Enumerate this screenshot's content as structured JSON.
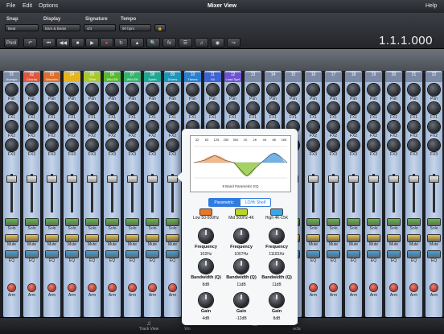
{
  "menu": {
    "items": [
      "File",
      "Edit",
      "Options"
    ],
    "title": "Mixer View",
    "help": "Help"
  },
  "toolbar": {
    "snap": {
      "label": "Snap",
      "value": "Beat"
    },
    "display": {
      "label": "Display",
      "value": "Bars & Beats"
    },
    "signature": {
      "label": "Signature",
      "value": "4/4"
    },
    "tempo": {
      "label": "Tempo",
      "value": "90 bpm"
    },
    "pool_label": "Pool",
    "counter": "1.1.1.000",
    "fx_label": "fx",
    "icons": [
      "undo-icon",
      "rewind-icon",
      "back-icon",
      "stop-icon",
      "play-icon",
      "record-icon",
      "loop-icon",
      "metronome-icon",
      "zoom-icon",
      "fx-icon",
      "mixer-icon",
      "tuner-icon",
      "binoculars-icon",
      "route-icon"
    ]
  },
  "strip_labels": {
    "pan": "Pan",
    "fx1": "FX1",
    "fx2": "FX2",
    "fx3": "FX3",
    "solo": "Solo",
    "mute": "Mute",
    "eq": "EQ",
    "arm": "Arm"
  },
  "tracks": [
    {
      "num": "01",
      "name": "Arpegio",
      "color": "#7c8aa5"
    },
    {
      "num": "02",
      "name": "Chords",
      "color": "#e1573c"
    },
    {
      "num": "03",
      "name": "Wooden",
      "color": "#e06e2b"
    },
    {
      "num": "04",
      "name": "",
      "color": "#e8b41c"
    },
    {
      "num": "05",
      "name": "Tribe",
      "color": "#a9c92a"
    },
    {
      "num": "06",
      "name": "Wild Eff",
      "color": "#57ba2d"
    },
    {
      "num": "07",
      "name": "Wild Eff",
      "color": "#33b56a"
    },
    {
      "num": "08",
      "name": "Synth",
      "color": "#1fa890"
    },
    {
      "num": "09",
      "name": "Drums",
      "color": "#1f95b8"
    },
    {
      "num": "10",
      "name": "Theme",
      "color": "#2a7fd0"
    },
    {
      "num": "11",
      "name": "Mi",
      "color": "#3f63d4"
    },
    {
      "num": "12",
      "name": "Lead Synt",
      "color": "#6e52d0"
    },
    {
      "num": "13",
      "name": "",
      "color": "#7c8aa5"
    },
    {
      "num": "14",
      "name": "",
      "color": "#7c8aa5"
    },
    {
      "num": "15",
      "name": "",
      "color": "#7c8aa5"
    },
    {
      "num": "16",
      "name": "",
      "color": "#7c8aa5"
    },
    {
      "num": "17",
      "name": "",
      "color": "#7c8aa5"
    },
    {
      "num": "18",
      "name": "",
      "color": "#7c8aa5"
    },
    {
      "num": "19",
      "name": "",
      "color": "#7c8aa5"
    },
    {
      "num": "20",
      "name": "",
      "color": "#7c8aa5"
    },
    {
      "num": "21",
      "name": "",
      "color": "#7c8aa5"
    },
    {
      "num": "22",
      "name": "",
      "color": "#7c8aa5"
    }
  ],
  "eq_popup": {
    "freq_labels": [
      "32",
      "63",
      "125",
      "250",
      "500",
      "1K",
      "2K",
      "4K",
      "8K",
      "16K"
    ],
    "graph_caption": "9 Band Parametric EQ",
    "modes": [
      "Parametric",
      "LO/Hi Shelf"
    ],
    "active_mode": "Parametric",
    "bands": [
      {
        "name": "Low 50-500Hz",
        "led": "#e8772a",
        "frequency": "102Hz",
        "bandwidth": "8dB",
        "gain": "4dB",
        "gain_level": 0.58
      },
      {
        "name": "Mid 500Hz-4K",
        "led": "#b8d62a",
        "frequency": "1007Hz",
        "bandwidth": "11dB",
        "gain": "-12dB",
        "gain_level": 0.0
      },
      {
        "name": "High 4K-15K",
        "led": "#3aa6e8",
        "frequency": "11181Hz",
        "bandwidth": "11dB",
        "gain": "8dB",
        "gain_level": 0.75
      }
    ],
    "param_labels": {
      "frequency": "Frequency",
      "bandwidth": "Bandwidth (Q)",
      "gain": "Gain"
    }
  },
  "tabs": [
    {
      "label": "Track View",
      "icon": "music-note-icon"
    },
    {
      "label": "Wo",
      "icon": "list-icon"
    },
    {
      "label": "",
      "icon": "edit-icon"
    },
    {
      "label": "",
      "icon": "grid-icon"
    },
    {
      "label": "ects",
      "icon": "fx-icon"
    }
  ],
  "colors": {
    "accent": "#2f7be0",
    "strip": "#b3c6e2",
    "solo": "#58c23a",
    "mute": "#f2c53a",
    "eq": "#38a6e8",
    "arm": "#e03a2a"
  }
}
